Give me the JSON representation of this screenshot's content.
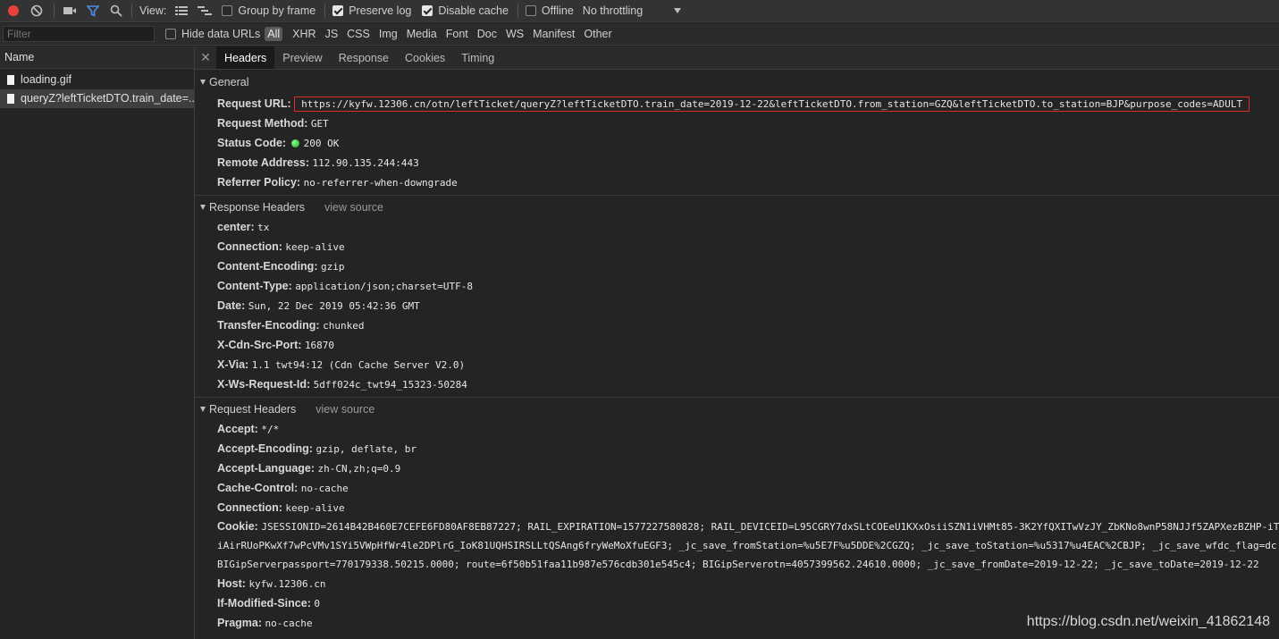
{
  "toolbar": {
    "view_label": "View:",
    "group_by_frame": "Group by frame",
    "preserve_log": "Preserve log",
    "disable_cache": "Disable cache",
    "offline": "Offline",
    "throttling": "No throttling"
  },
  "filterbar": {
    "filter_placeholder": "Filter",
    "hide_data_urls": "Hide data URLs",
    "types": [
      "All",
      "XHR",
      "JS",
      "CSS",
      "Img",
      "Media",
      "Font",
      "Doc",
      "WS",
      "Manifest",
      "Other"
    ]
  },
  "requests": {
    "header": "Name",
    "items": [
      "loading.gif",
      "queryZ?leftTicketDTO.train_date=..."
    ]
  },
  "tabs": [
    "Headers",
    "Preview",
    "Response",
    "Cookies",
    "Timing"
  ],
  "general": {
    "title": "General",
    "rows": [
      {
        "key": "Request URL:",
        "value": "https://kyfw.12306.cn/otn/leftTicket/queryZ?leftTicketDTO.train_date=2019-12-22&leftTicketDTO.from_station=GZQ&leftTicketDTO.to_station=BJP&purpose_codes=ADULT"
      },
      {
        "key": "Request Method:",
        "value": "GET"
      },
      {
        "key": "Status Code:",
        "value": "200 OK"
      },
      {
        "key": "Remote Address:",
        "value": "112.90.135.244:443"
      },
      {
        "key": "Referrer Policy:",
        "value": "no-referrer-when-downgrade"
      }
    ]
  },
  "response_headers": {
    "title": "Response Headers",
    "view_source": "view source",
    "rows": [
      {
        "key": "center:",
        "value": "tx"
      },
      {
        "key": "Connection:",
        "value": "keep-alive"
      },
      {
        "key": "Content-Encoding:",
        "value": "gzip"
      },
      {
        "key": "Content-Type:",
        "value": "application/json;charset=UTF-8"
      },
      {
        "key": "Date:",
        "value": "Sun, 22 Dec 2019 05:42:36 GMT"
      },
      {
        "key": "Transfer-Encoding:",
        "value": "chunked"
      },
      {
        "key": "X-Cdn-Src-Port:",
        "value": "16870"
      },
      {
        "key": "X-Via:",
        "value": "1.1 twt94:12 (Cdn Cache Server V2.0)"
      },
      {
        "key": "X-Ws-Request-Id:",
        "value": "5dff024c_twt94_15323-50284"
      }
    ]
  },
  "request_headers": {
    "title": "Request Headers",
    "view_source": "view source",
    "rows_before": [
      {
        "key": "Accept:",
        "value": "*/*"
      },
      {
        "key": "Accept-Encoding:",
        "value": "gzip, deflate, br"
      },
      {
        "key": "Accept-Language:",
        "value": "zh-CN,zh;q=0.9"
      },
      {
        "key": "Cache-Control:",
        "value": "no-cache"
      },
      {
        "key": "Connection:",
        "value": "keep-alive"
      }
    ],
    "cookie": {
      "key": "Cookie:",
      "line1": "JSESSIONID=2614B42B460E7CEFE6FD80AF8EB87227; RAIL_EXPIRATION=1577227580828; RAIL_DEVICEID=L95CGRY7dxSLtCOEeU1KXxOsiiSZN1iVHMt85-3K2YfQXITwVzJY_ZbKNo8wnP58NJJf5ZAPXezBZHP-iT",
      "line2": "iAirRUoPKwXf7wPcVMv1SYi5VWpHfWr4le2DPlrG_IoK81UQHSIRSLLtQSAng6fryWeMoXfuEGF3; _jc_save_fromStation=%u5E7F%u5DDE%2CGZQ; _jc_save_toStation=%u5317%u4EAC%2CBJP; _jc_save_wfdc_flag=dc",
      "line3": "BIGipServerpassport=770179338.50215.0000; route=6f50b51faa11b987e576cdb301e545c4; BIGipServerotn=4057399562.24610.0000; _jc_save_fromDate=2019-12-22; _jc_save_toDate=2019-12-22"
    },
    "rows_after": [
      {
        "key": "Host:",
        "value": "kyfw.12306.cn"
      },
      {
        "key": "If-Modified-Since:",
        "value": "0"
      },
      {
        "key": "Pragma:",
        "value": "no-cache"
      }
    ]
  },
  "watermark": "https://blog.csdn.net/weixin_41862148",
  "colors": {
    "record": "#e8413c",
    "filter_active": "#4c8ee8",
    "status_ok": "#1aa31a",
    "url_highlight": "#e02b2b"
  }
}
